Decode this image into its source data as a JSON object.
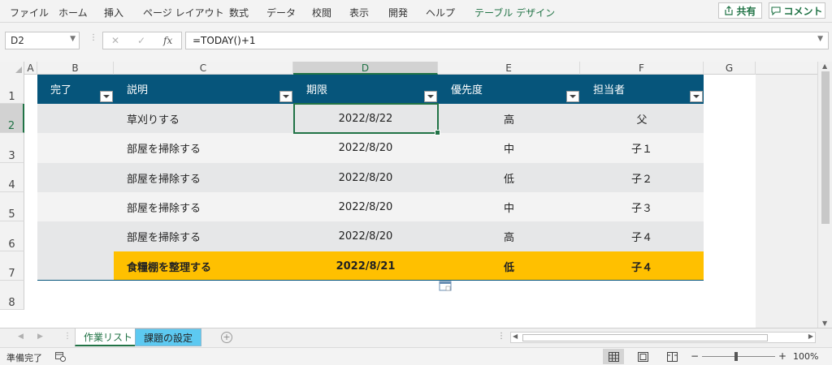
{
  "ribbon": {
    "tabs": [
      "ファイル",
      "ホーム",
      "挿入",
      "ページ レイアウト",
      "数式",
      "データ",
      "校閲",
      "表示",
      "開発",
      "ヘルプ",
      "テーブル デザイン"
    ],
    "share_label": "共有",
    "comment_label": "コメント"
  },
  "formula_bar": {
    "name_box": "D2",
    "fx_label": "fx",
    "formula": "=TODAY()+1"
  },
  "grid": {
    "columns": [
      "A",
      "B",
      "C",
      "D",
      "E",
      "F",
      "G"
    ],
    "rows": [
      "1",
      "2",
      "3",
      "4",
      "5",
      "6",
      "7",
      "8"
    ],
    "selected_cell": "D2"
  },
  "table": {
    "headers": [
      "完了",
      "説明",
      "期限",
      "優先度",
      "担当者"
    ],
    "rows": [
      {
        "done": "",
        "desc": "草刈りする",
        "due": "2022/8/22",
        "priority": "高",
        "owner": "父"
      },
      {
        "done": "",
        "desc": "部屋を掃除する",
        "due": "2022/8/20",
        "priority": "中",
        "owner": "子１"
      },
      {
        "done": "",
        "desc": "部屋を掃除する",
        "due": "2022/8/20",
        "priority": "低",
        "owner": "子２"
      },
      {
        "done": "",
        "desc": "部屋を掃除する",
        "due": "2022/8/20",
        "priority": "中",
        "owner": "子３"
      },
      {
        "done": "",
        "desc": "部屋を掃除する",
        "due": "2022/8/20",
        "priority": "高",
        "owner": "子４"
      },
      {
        "done": "",
        "desc": "食糧棚を整理する",
        "due": "2022/8/21",
        "priority": "低",
        "owner": "子４"
      }
    ],
    "colors": {
      "header_bg": "#06557b",
      "highlight": "#ffc000",
      "band_dark": "#e6e7e8",
      "band_light": "#f3f3f3"
    }
  },
  "sheets": [
    {
      "name": "作業リスト",
      "active": true
    },
    {
      "name": "課題の設定",
      "active": false
    }
  ],
  "status": {
    "ready": "準備完了",
    "zoom_minus": "−",
    "zoom_plus": "+",
    "zoom": "100%"
  },
  "icons": [
    "share-icon",
    "comment-icon",
    "cancel-icon",
    "enter-icon",
    "insert-function-icon",
    "quick-analysis-icon",
    "normal-view-icon",
    "page-layout-view-icon",
    "page-break-view-icon",
    "add-sheet-icon",
    "macro-record-icon"
  ]
}
